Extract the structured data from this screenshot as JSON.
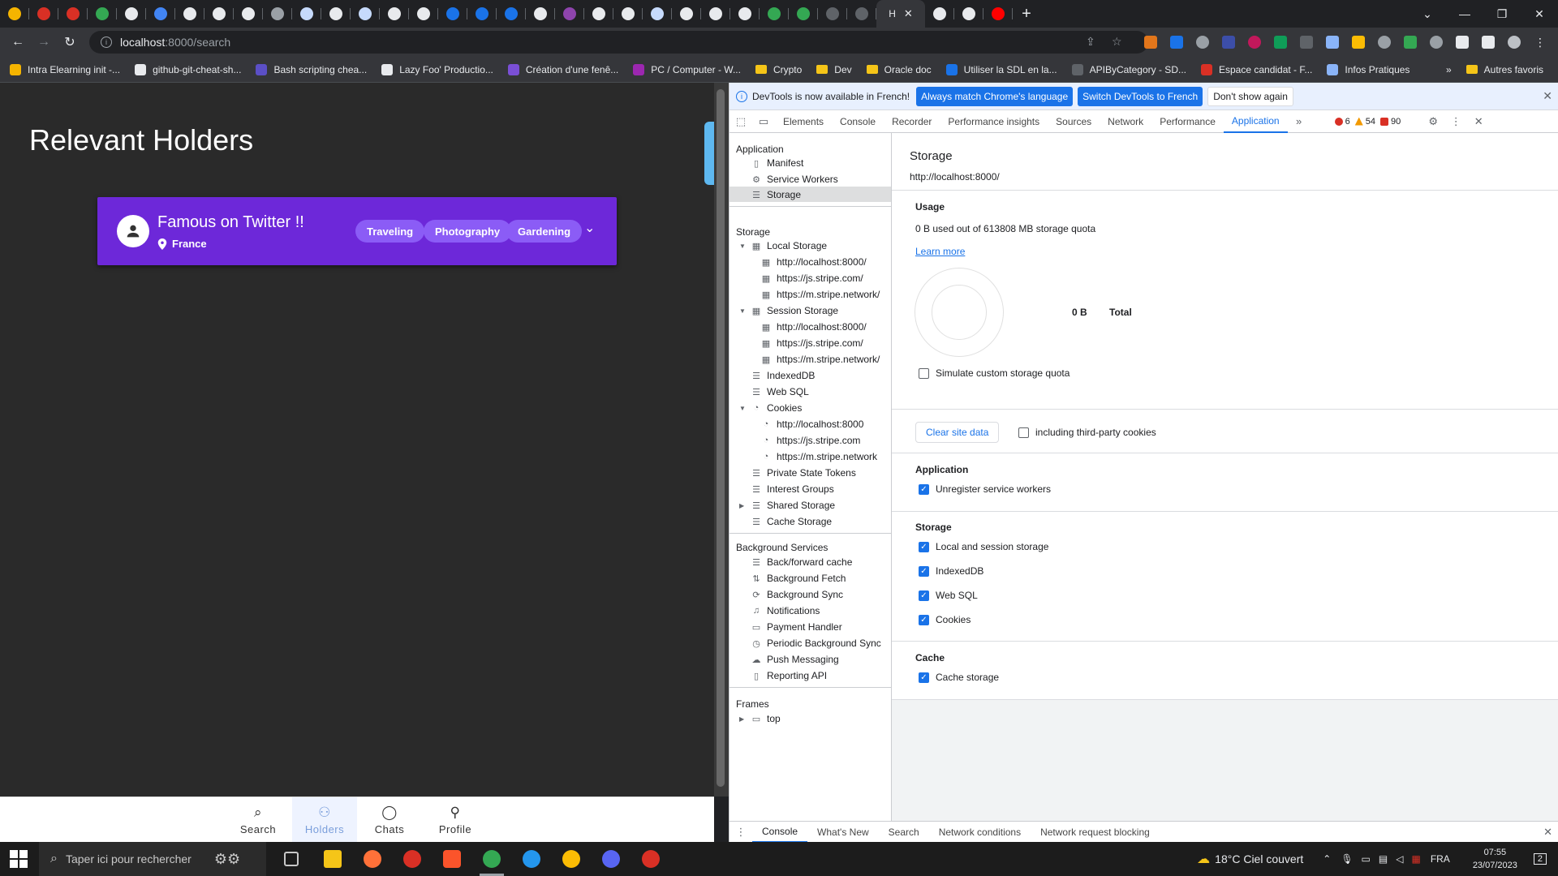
{
  "browser": {
    "url_host": "localhost",
    "url_path": ":8000/search",
    "active_tab_title": "H",
    "tab_colors": [
      "#f5b400",
      "#d93025",
      "#d93025",
      "#34a853",
      "#e8eaed",
      "#4285f4",
      "#e8eaed",
      "#e8eaed",
      "#e8eaed",
      "#9aa0a6",
      "#c6dafc",
      "#e8eaed",
      "#c6dafc",
      "#e8eaed",
      "#e8eaed",
      "#1a73e8",
      "#1a73e8",
      "#1a73e8",
      "#e8eaed",
      "#8e44ad",
      "#e8eaed",
      "#e8eaed",
      "#c6dafc",
      "#e8eaed",
      "#e8eaed",
      "#e8eaed",
      "#34a853",
      "#34a853",
      "#5f6368",
      "#5f6368",
      "#e8eaed",
      "#e8eaed",
      "#ff0000"
    ],
    "bookmarks": [
      {
        "label": "Intra Elearning init -...",
        "color": "#f5b400"
      },
      {
        "label": "github-git-cheat-sh...",
        "color": "#e8eaed"
      },
      {
        "label": "Bash scripting chea...",
        "color": "#5b4fc6"
      },
      {
        "label": "Lazy Foo' Productio...",
        "color": "#e8eaed"
      },
      {
        "label": "Création d'une fenê...",
        "color": "#7a4fd6"
      },
      {
        "label": "PC / Computer - W...",
        "color": "#9c27b0"
      },
      {
        "label": "Crypto",
        "folder": true
      },
      {
        "label": "Dev",
        "folder": true
      },
      {
        "label": "Oracle doc",
        "folder": true
      },
      {
        "label": "Utiliser la SDL en la...",
        "color": "#1a73e8"
      },
      {
        "label": "APIByCategory - SD...",
        "color": "#5f6368"
      },
      {
        "label": "Espace candidat - F...",
        "color": "#d93025"
      },
      {
        "label": "Infos Pratiques",
        "color": "#8ab4f8"
      }
    ],
    "other_bookmarks": "Autres favoris"
  },
  "page": {
    "title": "Relevant Holders",
    "holder": {
      "name": "Famous on Twitter !!",
      "location": "France",
      "tags": [
        "Traveling",
        "Photography",
        "Gardening"
      ]
    },
    "nav": {
      "search": "Search",
      "holders": "Holders",
      "chats": "Chats",
      "profile": "Profile"
    }
  },
  "devtools": {
    "infobar": {
      "message": "DevTools is now available in French!",
      "match_btn": "Always match Chrome's language",
      "switch_btn": "Switch DevTools to French",
      "dismiss_btn": "Don't show again"
    },
    "tabs": [
      "Elements",
      "Console",
      "Recorder",
      "Performance insights",
      "Sources",
      "Network",
      "Performance",
      "Application"
    ],
    "counts": {
      "errors": "6",
      "warnings": "54",
      "issues": "90"
    },
    "sidebar": {
      "application_header": "Application",
      "manifest": "Manifest",
      "service_workers": "Service Workers",
      "storage_item": "Storage",
      "storage_header": "Storage",
      "local_storage": "Local Storage",
      "ls_1": "http://localhost:8000/",
      "ls_2": "https://js.stripe.com/",
      "ls_3": "https://m.stripe.network/",
      "session_storage": "Session Storage",
      "ss_1": "http://localhost:8000/",
      "ss_2": "https://js.stripe.com/",
      "ss_3": "https://m.stripe.network/",
      "indexeddb": "IndexedDB",
      "websql": "Web SQL",
      "cookies": "Cookies",
      "ck_1": "http://localhost:8000",
      "ck_2": "https://js.stripe.com",
      "ck_3": "https://m.stripe.network",
      "private_state_tokens": "Private State Tokens",
      "interest_groups": "Interest Groups",
      "shared_storage": "Shared Storage",
      "cache_storage": "Cache Storage",
      "bg_header": "Background Services",
      "bfcache": "Back/forward cache",
      "bg_fetch": "Background Fetch",
      "bg_sync": "Background Sync",
      "notifications": "Notifications",
      "payment_handler": "Payment Handler",
      "periodic_sync": "Periodic Background Sync",
      "push_messaging": "Push Messaging",
      "reporting_api": "Reporting API",
      "frames_header": "Frames",
      "top": "top"
    },
    "main": {
      "title": "Storage",
      "origin": "http://localhost:8000/",
      "usage_header": "Usage",
      "usage_text": "0 B used out of 613808 MB storage quota",
      "learn_more": "Learn more",
      "total_value": "0 B",
      "total_label": "Total",
      "simulate": "Simulate custom storage quota",
      "clear_btn": "Clear site data",
      "third_party": "including third-party cookies",
      "application_header": "Application",
      "unregister": "Unregister service workers",
      "storage_header": "Storage",
      "local_session": "Local and session storage",
      "indexeddb": "IndexedDB",
      "websql": "Web SQL",
      "cookies": "Cookies",
      "cache_header": "Cache",
      "cache_storage": "Cache storage"
    },
    "drawer_tabs": [
      "Console",
      "What's New",
      "Search",
      "Network conditions",
      "Network request blocking"
    ]
  },
  "taskbar": {
    "search_placeholder": "Taper ici pour rechercher",
    "weather": "18°C  Ciel couvert",
    "lang": "FRA",
    "time": "07:55",
    "date": "23/07/2023",
    "notif_count": "2"
  },
  "colors": {
    "card": "#6d28d9",
    "tag": "#8b5cf6",
    "accent": "#1a73e8"
  }
}
